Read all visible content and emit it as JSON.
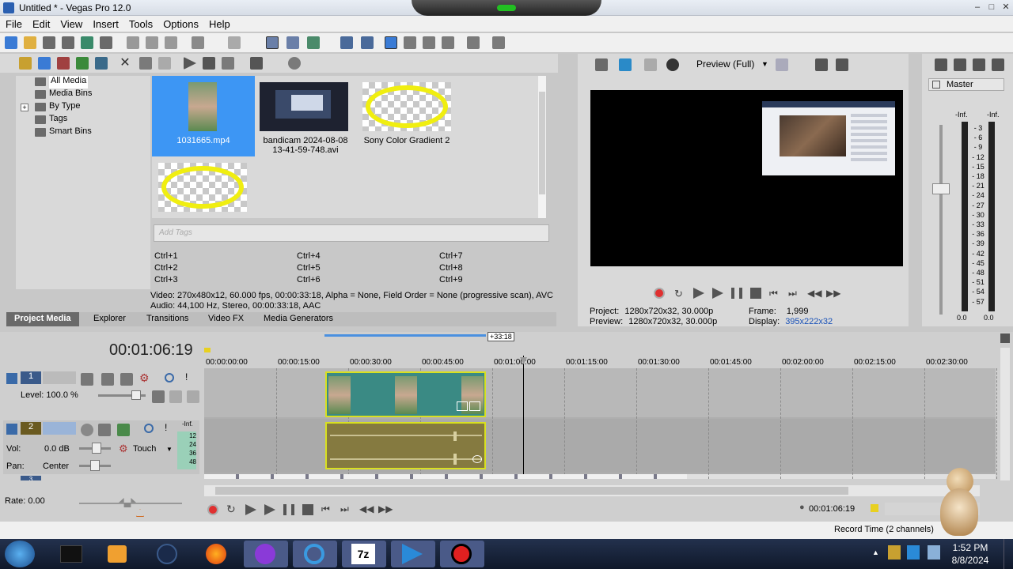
{
  "window": {
    "title": "Untitled * - Vegas Pro 12.0"
  },
  "menu": [
    "File",
    "Edit",
    "View",
    "Insert",
    "Tools",
    "Options",
    "Help"
  ],
  "tree": [
    "All Media",
    "Media Bins",
    "By Type",
    "Tags",
    "Smart Bins"
  ],
  "media": [
    {
      "name": "1031665.mp4"
    },
    {
      "name": "bandicam 2024-08-08 13-41-59-748.avi"
    },
    {
      "name": "Sony Color Gradient 2"
    },
    {
      "name": ""
    }
  ],
  "tags": {
    "placeholder": "Add Tags"
  },
  "shortcuts": [
    "Ctrl+1",
    "Ctrl+4",
    "Ctrl+7",
    "Ctrl+2",
    "Ctrl+5",
    "Ctrl+8",
    "Ctrl+3",
    "Ctrl+6",
    "Ctrl+9"
  ],
  "media_info": {
    "video": "Video: 270x480x12, 60.000 fps, 00:00:33:18, Alpha = None, Field Order = None (progressive scan), AVC",
    "audio": "Audio: 44,100 Hz, Stereo, 00:00:33:18, AAC"
  },
  "tabs": [
    "Project Media",
    "Explorer",
    "Transitions",
    "Video FX",
    "Media Generators"
  ],
  "preview": {
    "mode": "Preview (Full)",
    "project_label": "Project:",
    "project_value": "1280x720x32, 30.000p",
    "preview_label": "Preview:",
    "preview_value": "1280x720x32, 30.000p",
    "frame_label": "Frame:",
    "frame_value": "1,999",
    "display_label": "Display:",
    "display_value": "395x222x32"
  },
  "master": {
    "label": "Master",
    "inf_left": "-Inf.",
    "inf_right": "-Inf.",
    "scale": [
      "3",
      "6",
      "9",
      "12",
      "15",
      "18",
      "21",
      "24",
      "27",
      "30",
      "33",
      "36",
      "39",
      "42",
      "45",
      "48",
      "51",
      "54",
      "57"
    ],
    "bottom_left": "0.0",
    "bottom_right": "0.0"
  },
  "timeline": {
    "timecode": "00:01:06:19",
    "selection_length": "+33:18",
    "ruler": [
      "00:00:00:00",
      "00:00:15:00",
      "00:00:30:00",
      "00:00:45:00",
      "00:01:00:00",
      "00:01:15:00",
      "00:01:30:00",
      "00:01:45:00",
      "00:02:00:00",
      "00:02:15:00",
      "00:02:30:00"
    ],
    "track1": {
      "number": "1",
      "level": "Level: 100.0 %"
    },
    "track2": {
      "number": "2",
      "vol_label": "Vol:",
      "vol_value": "0.0 dB",
      "automation": "Touch",
      "pan_label": "Pan:",
      "pan_value": "Center",
      "inf": "-Inf.",
      "scale": [
        "12",
        "24",
        "36",
        "48"
      ]
    },
    "track3": {
      "number": "3"
    },
    "rate": "Rate: 0.00",
    "bottom_time": "00:01:06:19",
    "record_time": "Record Time (2 channels)"
  },
  "taskbar": {
    "time": "1:52 PM",
    "date": "8/8/2024"
  }
}
